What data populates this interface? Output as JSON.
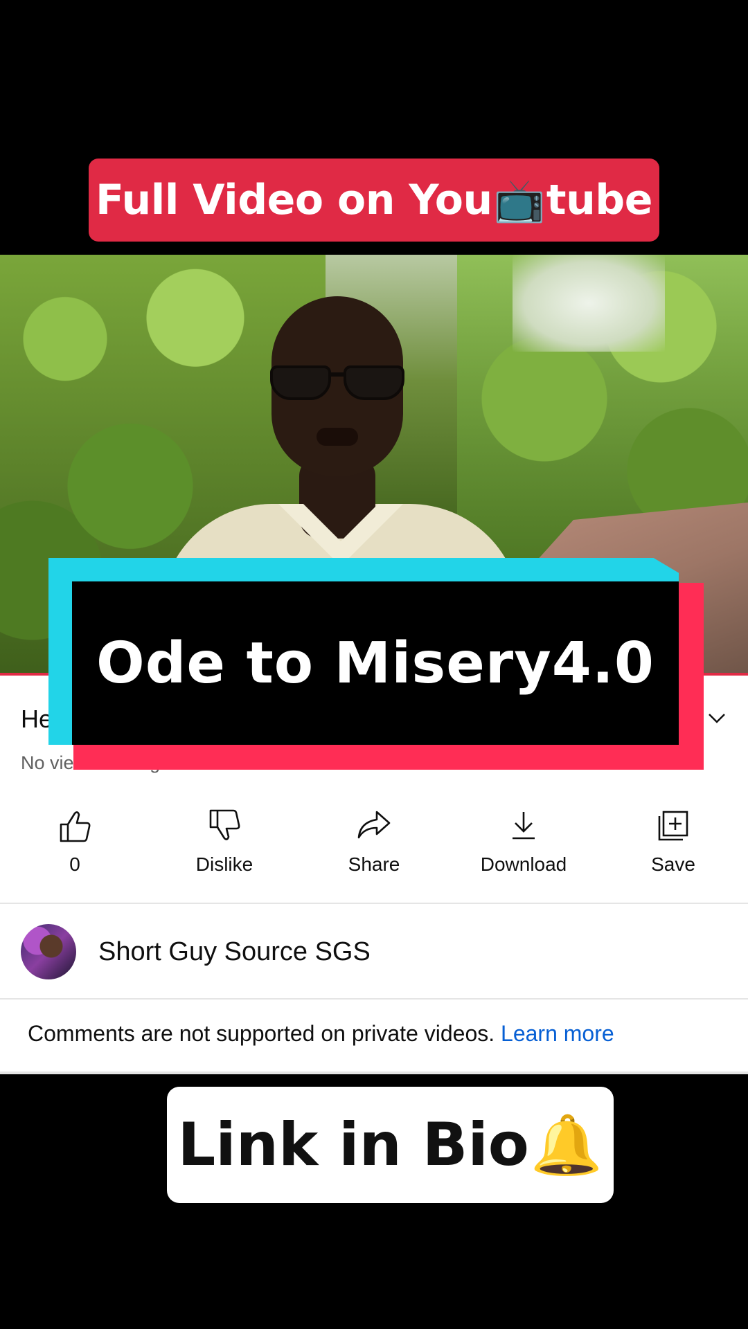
{
  "top_banner": {
    "text_before": "Full Video on You",
    "emoji": "📺",
    "text_after": "tube"
  },
  "overlay": {
    "title": "Ode to Misery4.0"
  },
  "video_info": {
    "title_partial": "He",
    "meta_partial": "No views · 3h ago"
  },
  "actions": [
    {
      "label": "0",
      "icon": "thumbs-up-icon"
    },
    {
      "label": "Dislike",
      "icon": "thumbs-down-icon"
    },
    {
      "label": "Share",
      "icon": "share-icon"
    },
    {
      "label": "Download",
      "icon": "download-icon"
    },
    {
      "label": "Save",
      "icon": "save-icon"
    }
  ],
  "channel": {
    "name": "Short Guy Source SGS"
  },
  "comments": {
    "text": "Comments are not supported on private videos. ",
    "link": "Learn more"
  },
  "bottom_pill": {
    "text": "Link in Bio",
    "emoji": "🔔"
  },
  "colors": {
    "banner": "#e02a45",
    "cyan": "#22d4e8",
    "pink": "#ff2d55",
    "link": "#065fd4"
  }
}
